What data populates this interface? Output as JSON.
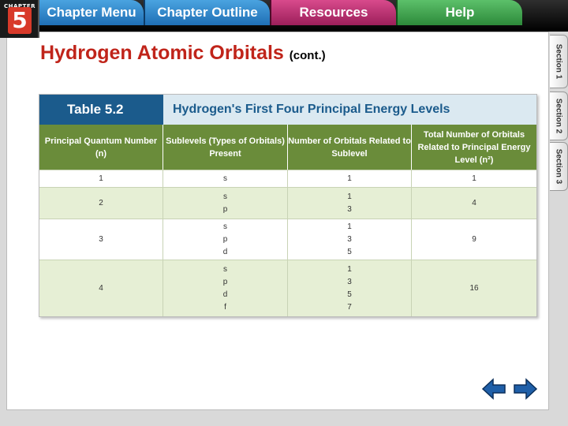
{
  "header": {
    "chapter_word": "CHAPTER",
    "chapter_number": "5",
    "tabs": [
      {
        "label": "Chapter Menu"
      },
      {
        "label": "Chapter Outline"
      },
      {
        "label": "Resources"
      },
      {
        "label": "Help"
      }
    ]
  },
  "slide": {
    "title": "Hydrogen Atomic Orbitals",
    "title_suffix": "(cont.)"
  },
  "table": {
    "label": "Table 5.2",
    "caption": "Hydrogen's First Four Principal Energy Levels",
    "columns": [
      "Principal Quantum Number (n)",
      "Sublevels (Types of Orbitals) Present",
      "Number of Orbitals Related to Sublevel",
      "Total Number of Orbitals Related to Principal Energy Level (n²)"
    ],
    "rows": [
      {
        "n": "1",
        "sublevels": [
          "s"
        ],
        "orbitals": [
          "1"
        ],
        "total": "1"
      },
      {
        "n": "2",
        "sublevels": [
          "s",
          "p"
        ],
        "orbitals": [
          "1",
          "3"
        ],
        "total": "4"
      },
      {
        "n": "3",
        "sublevels": [
          "s",
          "p",
          "d"
        ],
        "orbitals": [
          "1",
          "3",
          "5"
        ],
        "total": "9"
      },
      {
        "n": "4",
        "sublevels": [
          "s",
          "p",
          "d",
          "f"
        ],
        "orbitals": [
          "1",
          "3",
          "5",
          "7"
        ],
        "total": "16"
      }
    ]
  },
  "sections": [
    {
      "label": "Section 1"
    },
    {
      "label": "Section 2"
    },
    {
      "label": "Section 3"
    }
  ],
  "navigation": {
    "prev_icon": "left-arrow-icon",
    "next_icon": "right-arrow-icon",
    "arrow_color": "#1f5fa8"
  }
}
